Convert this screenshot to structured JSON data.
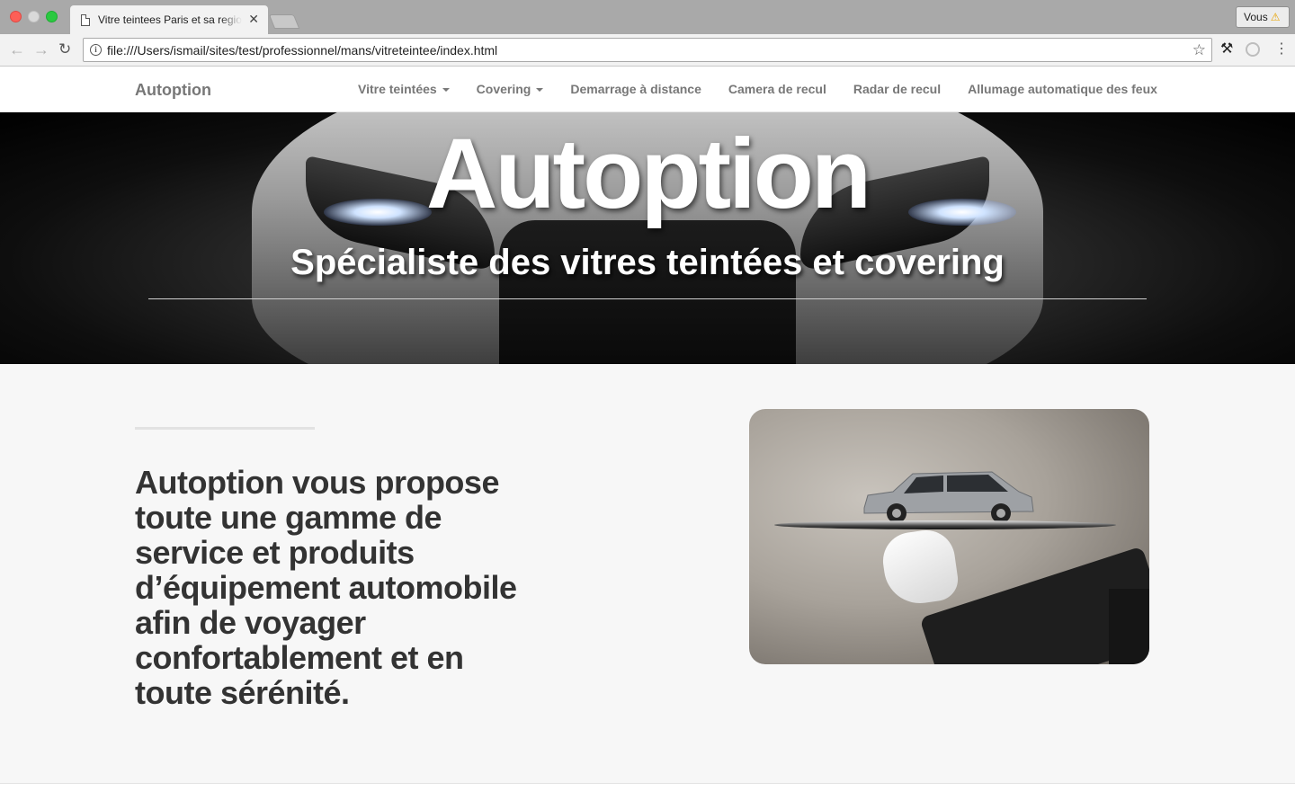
{
  "browser": {
    "tab_title": "Vitre teintees Paris et sa region",
    "tab_close": "✕",
    "url": "file:///Users/ismail/sites/test/professionnel/mans/vitreteintee/index.html",
    "profile_label": "Vous",
    "profile_warning": "⚠"
  },
  "navbar": {
    "brand": "Autoption",
    "links": [
      {
        "label": "Vitre teintées",
        "dropdown": true
      },
      {
        "label": "Covering",
        "dropdown": true
      },
      {
        "label": "Demarrage à distance",
        "dropdown": false
      },
      {
        "label": "Camera de recul",
        "dropdown": false
      },
      {
        "label": "Radar de recul",
        "dropdown": false
      },
      {
        "label": "Allumage automatique des feux",
        "dropdown": false
      }
    ]
  },
  "hero": {
    "title": "Autoption",
    "subtitle": "Spécialiste des vitres teintées et covering"
  },
  "content": {
    "text": "Autoption vous propose toute une gamme de service et produits d’équipement automobile afin de voyager confortablement et en toute sérénité."
  },
  "colors": {
    "brand_text": "#777777",
    "content_bg": "#f7f7f7",
    "heading": "#333333"
  }
}
